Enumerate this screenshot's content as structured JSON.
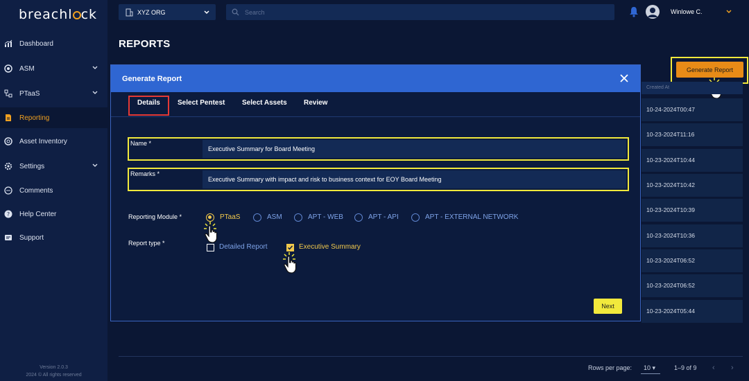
{
  "sidebar": {
    "logo_text": "breachl",
    "logo_text_end": "ck",
    "items": [
      {
        "label": "Dashboard"
      },
      {
        "label": "ASM"
      },
      {
        "label": "PTaaS"
      },
      {
        "label": "Reporting"
      },
      {
        "label": "Asset Inventory"
      },
      {
        "label": "Settings"
      },
      {
        "label": "Comments"
      },
      {
        "label": "Help Center"
      },
      {
        "label": "Support"
      }
    ],
    "version": "Version 2.0.3",
    "copyright": "2024 © All rights reserved"
  },
  "topbar": {
    "org": "XYZ ORG",
    "search_placeholder": "Search",
    "user_name": "Winlowe C."
  },
  "page": {
    "title": "REPORTS",
    "generate_button": "Generate Report"
  },
  "table": {
    "column_header": "Created At",
    "rows": [
      "10-24-2024T00:47",
      "10-23-2024T11:16",
      "10-23-2024T10:44",
      "10-23-2024T10:42",
      "10-23-2024T10:39",
      "10-23-2024T10:36",
      "10-23-2024T06:52",
      "10-23-2024T06:52",
      "10-23-2024T05:44"
    ]
  },
  "pagination": {
    "rows_per_page_label": "Rows per page:",
    "rows_per_page_value": "10",
    "range": "1–9 of 9"
  },
  "modal": {
    "title": "Generate Report",
    "tabs": [
      "Details",
      "Select Pentest",
      "Select Assets",
      "Review"
    ],
    "name_label": "Name *",
    "name_value": "Executive Summary for Board Meeting",
    "remarks_label": "Remarks *",
    "remarks_value": "Executive Summary with impact and risk to business context for EOY Board Meeting",
    "module_label": "Reporting Module *",
    "modules": [
      "PTaaS",
      "ASM",
      "APT - WEB",
      "APT - API",
      "APT - EXTERNAL NETWORK"
    ],
    "selected_module": "PTaaS",
    "report_type_label": "Report type *",
    "report_types": [
      "Detailed Report",
      "Executive Summary"
    ],
    "selected_report_type": "Executive Summary",
    "next_button": "Next"
  },
  "colors": {
    "accent_orange": "#e88b17",
    "highlight_yellow": "#f2e93c",
    "active_tab_red": "#e53935",
    "modal_header_blue": "#2f66d2"
  }
}
